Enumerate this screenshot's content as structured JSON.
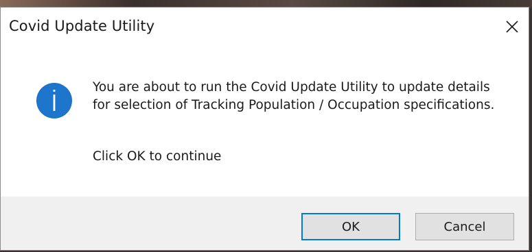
{
  "dialog": {
    "title": "Covid Update Utility",
    "close_icon": "close-icon",
    "info_icon": "information-icon",
    "message": "You are about to run the Covid Update Utility to update details for selection of Tracking Population / Occupation specifications.",
    "continue_text": "Click OK to continue",
    "buttons": {
      "ok_label": "OK",
      "cancel_label": "Cancel"
    },
    "colors": {
      "accent": "#0078d7",
      "info_icon_fill": "#1a6fc4",
      "footer_bg": "#f0f0f0"
    }
  }
}
